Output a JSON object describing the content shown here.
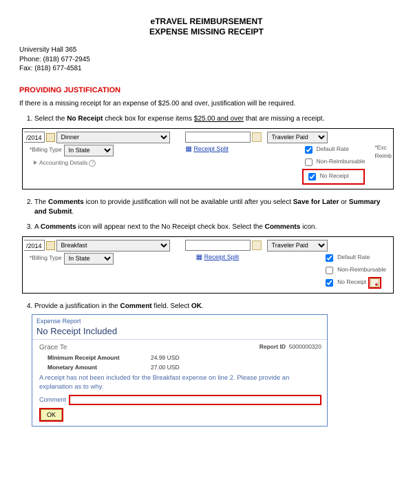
{
  "header": {
    "title1": "eTRAVEL REIMBURSEMENT",
    "title2": "EXPENSE MISSING RECEIPT"
  },
  "contact": {
    "address": "University Hall 365",
    "phone_label": "Phone:",
    "phone": "(818) 677-2945",
    "fax_label": "Fax:",
    "fax": "(818) 677-4581"
  },
  "section_head": "PROVIDING JUSTIFICATION",
  "intro": "If there is a missing receipt for an expense of $25.00 and over, justification will be required.",
  "steps": {
    "s1a": "Select the ",
    "s1b": "No Receipt",
    "s1c": " check box for expense items ",
    "s1d": "$25.00 and over",
    "s1e": " that are missing a receipt.",
    "s2a": "The ",
    "s2b": "Comments",
    "s2c": " icon to provide justification will not be available until after you select ",
    "s2d": "Save for Later",
    "s2e": " or ",
    "s2f": "Summary and Submit",
    "s2g": ".",
    "s3a": "A ",
    "s3b": "Comments",
    "s3c": " icon will appear next to the No Receipt check box. Select the ",
    "s3d": "Comments",
    "s3e": " icon.",
    "s4a": "Provide a justification in the ",
    "s4b": "Comment",
    "s4c": " field. Select ",
    "s4d": "OK",
    "s4e": "."
  },
  "shot1": {
    "date_frag": "/2014",
    "expense_type": "Dinner",
    "billing_label": "*Billing Type",
    "billing_value": "In State",
    "receipt_split": "Receipt Split",
    "pay_type": "Traveler Paid",
    "opt_default": "Default Rate",
    "opt_nonreimb": "Non-Reimbursable",
    "opt_noreceipt": "No Receipt",
    "side_exc": "*Exc",
    "side_reimb": "Reimb",
    "acct": "Accounting Details"
  },
  "shot2": {
    "date_frag": "/2014",
    "expense_type": "Breakfast",
    "billing_label": "*Billing Type",
    "billing_value": "In State",
    "receipt_split": "Receipt Split",
    "pay_type": "Traveler Paid",
    "opt_default": "Default Rate",
    "opt_nonreimb": "Non-Reimbursable",
    "opt_noreceipt": "No Receipt"
  },
  "dlg": {
    "head": "Expense Report",
    "title": "No Receipt Included",
    "name": "Grace Te",
    "report_id_label": "Report ID",
    "report_id": "5000000320",
    "k1": "Minimum Receipt Amount",
    "v1": "24.99   USD",
    "k2": "Monetary Amount",
    "v2": "27.00   USD",
    "msg": "A receipt has not been included for the Breakfast expense on line 2. Please provide an explanation as to why.",
    "comment_label": "Comment",
    "ok": "OK"
  }
}
